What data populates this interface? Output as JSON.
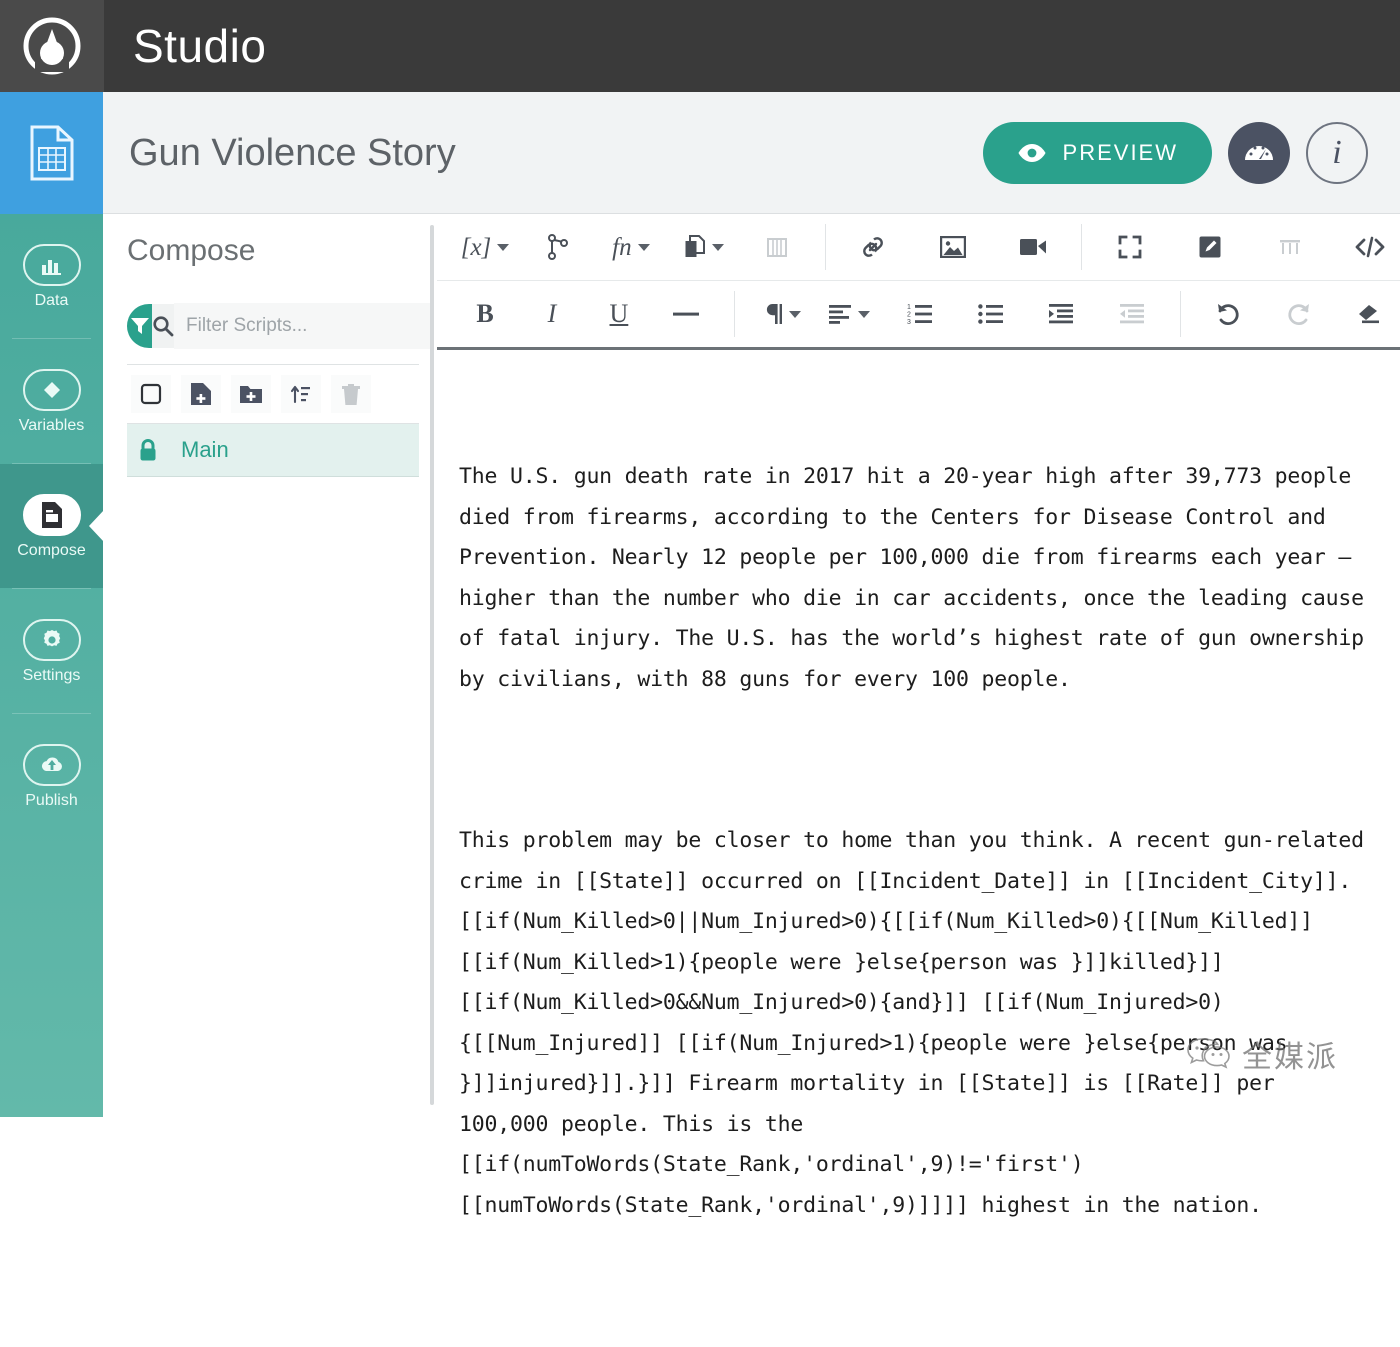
{
  "topbar": {
    "logo_name": "anchor-logo-icon",
    "app_title": "Studio"
  },
  "rail": {
    "items": [
      {
        "id": "project",
        "label": "",
        "icon": "spreadsheet-document-icon",
        "active": false,
        "highlight": true
      },
      {
        "id": "data",
        "label": "Data",
        "icon": "bar-chart-icon",
        "active": false,
        "highlight": false
      },
      {
        "id": "variables",
        "label": "Variables",
        "icon": "diamond-pin-icon",
        "active": false,
        "highlight": false
      },
      {
        "id": "compose",
        "label": "Compose",
        "icon": "compose-document-icon",
        "active": true,
        "highlight": false
      },
      {
        "id": "settings",
        "label": "Settings",
        "icon": "gear-icon",
        "active": false,
        "highlight": false
      },
      {
        "id": "publish",
        "label": "Publish",
        "icon": "cloud-upload-icon",
        "active": false,
        "highlight": false
      }
    ]
  },
  "header": {
    "doc_title": "Gun Violence Story",
    "preview_label": "PREVIEW",
    "preview_icon": "eye-icon",
    "gauge_icon": "speedometer-icon",
    "info_icon": "info-icon",
    "info_glyph": "i",
    "accent_color": "#2aa18c",
    "dark_circle_color": "#4b5263"
  },
  "compose": {
    "heading": "Compose",
    "filter_icon": "funnel-filter-icon",
    "search_icon": "search-icon",
    "filter_placeholder": "Filter Scripts...",
    "filter_value": "",
    "tools": [
      {
        "id": "select-all",
        "icon": "checkbox-empty-icon",
        "dim": false
      },
      {
        "id": "new-script",
        "icon": "new-file-icon",
        "dim": false
      },
      {
        "id": "new-folder",
        "icon": "new-folder-icon",
        "dim": false
      },
      {
        "id": "sort",
        "icon": "sort-ascending-icon",
        "dim": false
      },
      {
        "id": "delete",
        "icon": "trash-icon",
        "dim": true
      }
    ],
    "scripts": [
      {
        "name": "Main",
        "locked": true,
        "lock_icon": "lock-icon",
        "selected": true
      }
    ]
  },
  "editor": {
    "toolbar_row1": [
      {
        "id": "variable",
        "icon": "variable-bracket-icon",
        "glyph": "[x]",
        "caret": true,
        "dim": false,
        "divider_after": false
      },
      {
        "id": "branch",
        "icon": "branch-icon",
        "glyph": "",
        "caret": false,
        "dim": false,
        "divider_after": false
      },
      {
        "id": "function",
        "icon": "function-icon",
        "glyph": "fn",
        "caret": true,
        "dim": false,
        "divider_after": false
      },
      {
        "id": "snippet",
        "icon": "copy-snippet-icon",
        "glyph": "",
        "caret": true,
        "dim": false,
        "divider_after": false
      },
      {
        "id": "dictionary",
        "icon": "book-icon",
        "glyph": "",
        "caret": false,
        "dim": true,
        "divider_after": true
      },
      {
        "id": "link",
        "icon": "link-icon",
        "glyph": "",
        "caret": false,
        "dim": false,
        "divider_after": false
      },
      {
        "id": "image",
        "icon": "image-icon",
        "glyph": "",
        "caret": false,
        "dim": false,
        "divider_after": false
      },
      {
        "id": "video",
        "icon": "video-icon",
        "glyph": "",
        "caret": false,
        "dim": false,
        "divider_after": true
      },
      {
        "id": "fullscreen",
        "icon": "fullscreen-icon",
        "glyph": "",
        "caret": false,
        "dim": false,
        "divider_after": false
      },
      {
        "id": "annotate",
        "icon": "pencil-square-icon",
        "glyph": "",
        "caret": false,
        "dim": false,
        "divider_after": false
      },
      {
        "id": "alt-text",
        "icon": "alt-text-icon",
        "glyph": "",
        "caret": false,
        "dim": true,
        "divider_after": false
      },
      {
        "id": "source-code",
        "icon": "code-brackets-icon",
        "glyph": "",
        "caret": false,
        "dim": false,
        "divider_after": false
      }
    ],
    "toolbar_row2": [
      {
        "id": "bold",
        "icon": "bold-icon",
        "glyph": "B",
        "caret": false,
        "dim": false,
        "divider_after": false
      },
      {
        "id": "italic",
        "icon": "italic-icon",
        "glyph": "I",
        "caret": false,
        "dim": false,
        "divider_after": false
      },
      {
        "id": "underline",
        "icon": "underline-icon",
        "glyph": "U",
        "caret": false,
        "dim": false,
        "divider_after": false
      },
      {
        "id": "horizontal-rule",
        "icon": "horizontal-rule-icon",
        "glyph": "",
        "caret": false,
        "dim": false,
        "divider_after": true
      },
      {
        "id": "paragraph-style",
        "icon": "paragraph-pilcrow-icon",
        "glyph": "",
        "caret": true,
        "dim": false,
        "divider_after": false
      },
      {
        "id": "align",
        "icon": "align-left-icon",
        "glyph": "",
        "caret": true,
        "dim": false,
        "divider_after": false
      },
      {
        "id": "ordered-list",
        "icon": "ordered-list-icon",
        "glyph": "",
        "caret": false,
        "dim": false,
        "divider_after": false
      },
      {
        "id": "unordered-list",
        "icon": "unordered-list-icon",
        "glyph": "",
        "caret": false,
        "dim": false,
        "divider_after": false
      },
      {
        "id": "indent",
        "icon": "indent-increase-icon",
        "glyph": "",
        "caret": false,
        "dim": false,
        "divider_after": false
      },
      {
        "id": "outdent",
        "icon": "indent-decrease-icon",
        "glyph": "",
        "caret": false,
        "dim": true,
        "divider_after": true
      },
      {
        "id": "undo",
        "icon": "undo-icon",
        "glyph": "",
        "caret": false,
        "dim": false,
        "divider_after": false
      },
      {
        "id": "redo",
        "icon": "redo-icon",
        "glyph": "",
        "caret": false,
        "dim": true,
        "divider_after": false
      },
      {
        "id": "clear-formatting",
        "icon": "eraser-icon",
        "glyph": "",
        "caret": false,
        "dim": false,
        "divider_after": false
      }
    ],
    "document": {
      "paragraph_1": "The U.S. gun death rate in 2017 hit a 20-year high after 39,773 people died from firearms, according to the Centers for Disease Control and Prevention. Nearly 12 people per 100,000 die from firearms each year — higher than the number who die in car accidents, once the leading cause of fatal injury. The U.S. has the world’s highest rate of gun ownership by civilians, with 88 guns for every 100 people.",
      "paragraph_2": "This problem may be closer to home than you think. A recent gun-related crime in [[State]] occurred on [[Incident_Date]] in [[Incident_City]]. [[if(Num_Killed>0||Num_Injured>0){[[if(Num_Killed>0){[[Num_Killed]] [[if(Num_Killed>1){people were }else{person was }]]killed}]] [[if(Num_Killed>0&&Num_Injured>0){and}]] [[if(Num_Injured>0){[[Num_Injured]] [[if(Num_Injured>1){people were }else{person was }]]injured}]].}]] Firearm mortality in [[State]] is [[Rate]] per 100,000 people. This is the [[if(numToWords(State_Rank,'ordinal',9)!='first') [[numToWords(State_Rank,'ordinal',9)]]]] highest in the nation."
    }
  },
  "watermark": {
    "icon": "wechat-icon",
    "text": "全媒派"
  }
}
